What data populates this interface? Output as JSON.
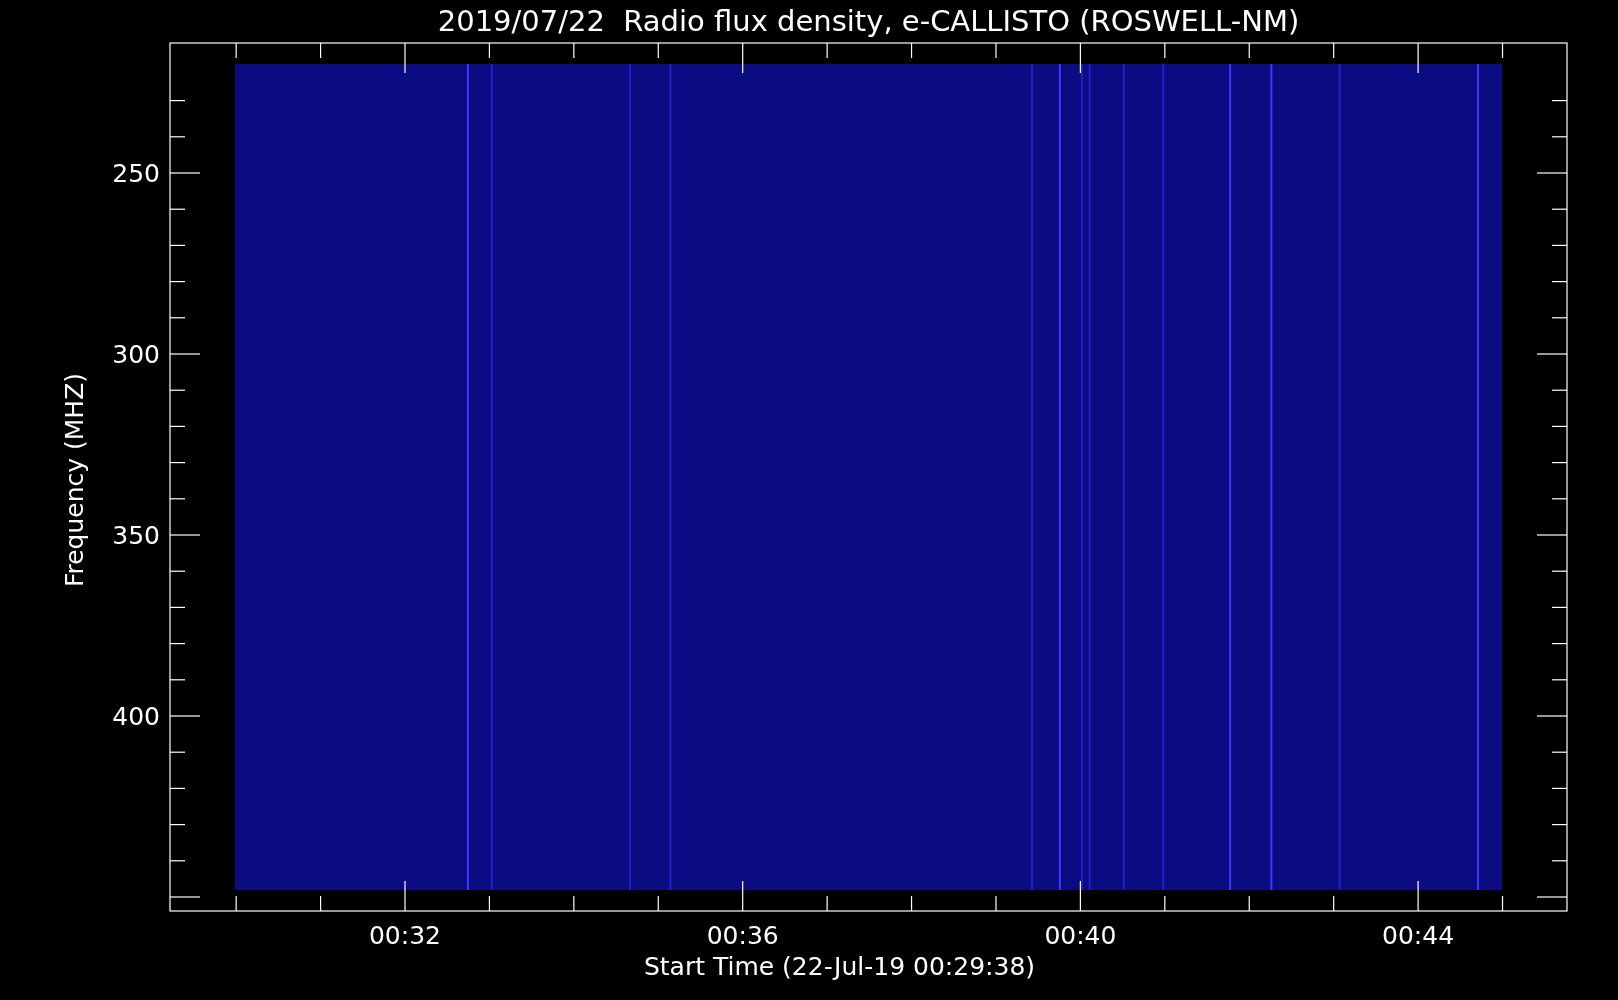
{
  "title": "2019/07/22  Radio flux density, e-CALLISTO (ROSWELL-NM)",
  "y_axis": {
    "label": "Frequency (MHZ)",
    "ticks": [
      "250",
      "300",
      "350",
      "400"
    ]
  },
  "x_axis": {
    "label": "Start Time (22-Jul-19 00:29:38)",
    "ticks": [
      "00:32",
      "00:36",
      "00:40",
      "00:44"
    ]
  }
}
